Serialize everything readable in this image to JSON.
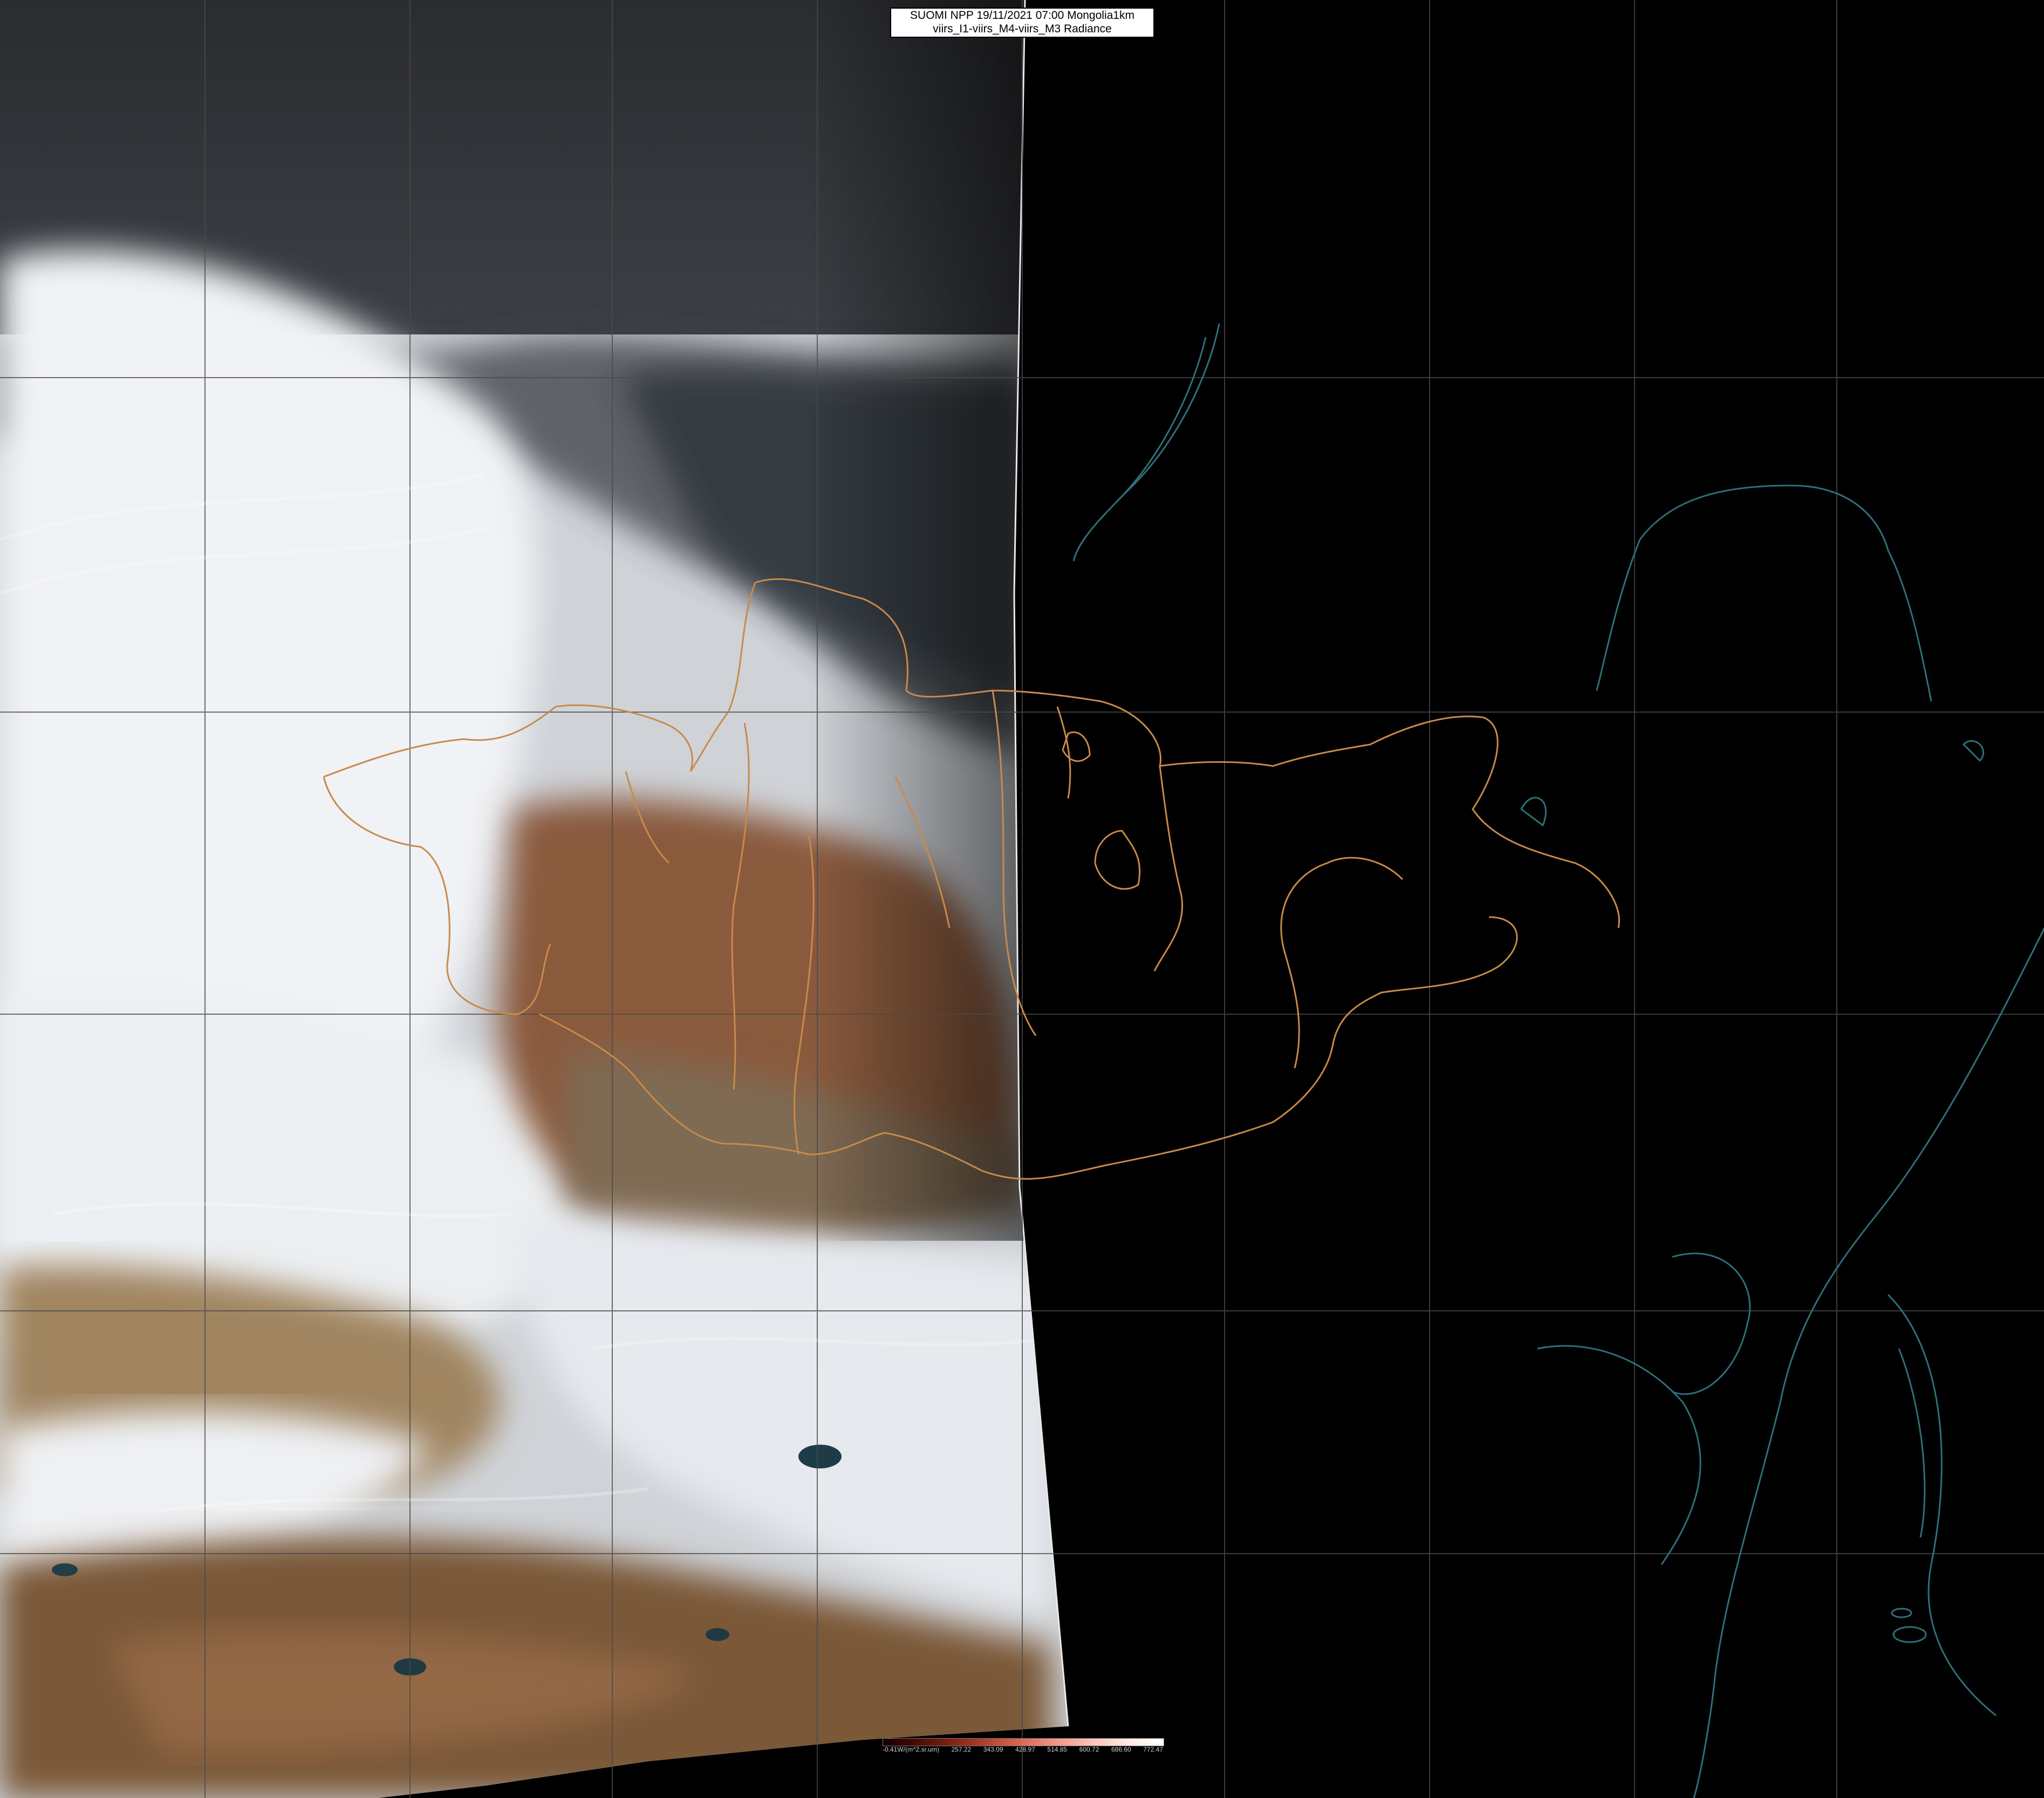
{
  "title": {
    "line1": "SUOMI NPP 19/11/2021 07:00 Mongolia1km",
    "line2": "viirs_I1-viirs_M4-viirs_M3 Radiance"
  },
  "colorbar": {
    "ticks": [
      "-0.41W/(m^2.sr.um)",
      "257.22",
      "343.09",
      "428.97",
      "514.85",
      "600.72",
      "686.60",
      "772.47"
    ],
    "colors": [
      "#120000",
      "#8e2a1a",
      "#f08f80",
      "#ffffff"
    ]
  },
  "colors": {
    "background": "#000000",
    "grid": "#4a4a4a",
    "coastline": "#2f6f7a",
    "boundaries": "#c88a4a",
    "cloud": "#e8ebef",
    "desert": "#a08560",
    "terrain_red": "#8a5a3e"
  }
}
